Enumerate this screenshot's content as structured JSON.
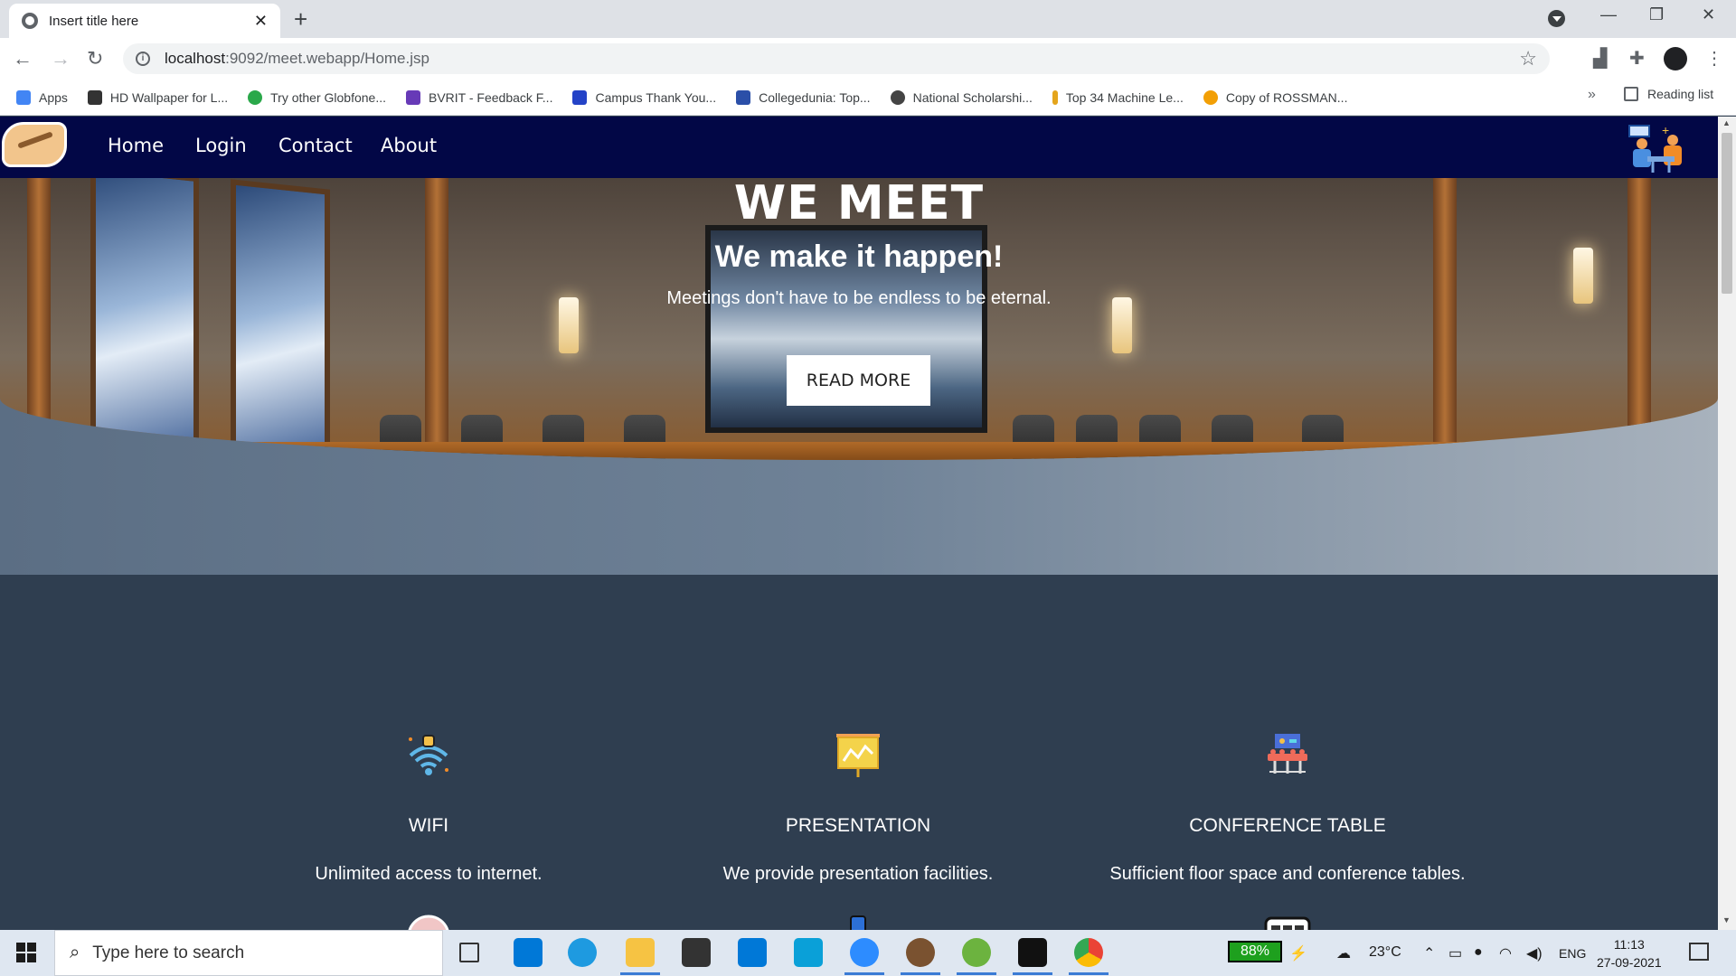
{
  "browser": {
    "tab_title": "Insert title here",
    "tab_close": "✕",
    "new_tab": "+",
    "url_host": "localhost",
    "url_rest": ":9092/meet.webapp/Home.jsp",
    "bookmarks": [
      {
        "label": "Apps",
        "color": "#4285f4"
      },
      {
        "label": "HD Wallpaper for L...",
        "color": "#333333"
      },
      {
        "label": "Try other Globfone...",
        "color": "#2aa84a"
      },
      {
        "label": "BVRIT - Feedback F...",
        "color": "#673ab7"
      },
      {
        "label": "Campus Thank You...",
        "color": "#2443c7"
      },
      {
        "label": "Collegedunia: Top...",
        "color": "#2b4fa8"
      },
      {
        "label": "National Scholarshi...",
        "color": "#444444"
      },
      {
        "label": "Top 34 Machine Le...",
        "color": "#e4a51c"
      },
      {
        "label": "Copy of ROSSMAN...",
        "color": "#f29f05"
      }
    ],
    "more_bookmarks": "»",
    "reading_list": "Reading list"
  },
  "site": {
    "nav": [
      "Home",
      "Login",
      "Contact",
      "About"
    ],
    "navbar_color": "#020746",
    "hero": {
      "title": "WE MEET",
      "subtitle": "We make it happen!",
      "tagline": "Meetings don't have to be endless to be eternal.",
      "button": "READ MORE"
    },
    "features": [
      {
        "icon": "wifi-icon",
        "title": "WIFI",
        "desc": "Unlimited access to internet."
      },
      {
        "icon": "presentation-icon",
        "title": "PRESENTATION",
        "desc": "We provide presentation facilities."
      },
      {
        "icon": "conference-table-icon",
        "title": "CONFERENCE TABLE",
        "desc": "Sufficient floor space and conference tables."
      }
    ]
  },
  "taskbar": {
    "search_placeholder": "Type here to search",
    "battery": "88%",
    "temperature": "23°C",
    "language": "ENG",
    "time": "11:13",
    "date": "27-09-2021"
  }
}
